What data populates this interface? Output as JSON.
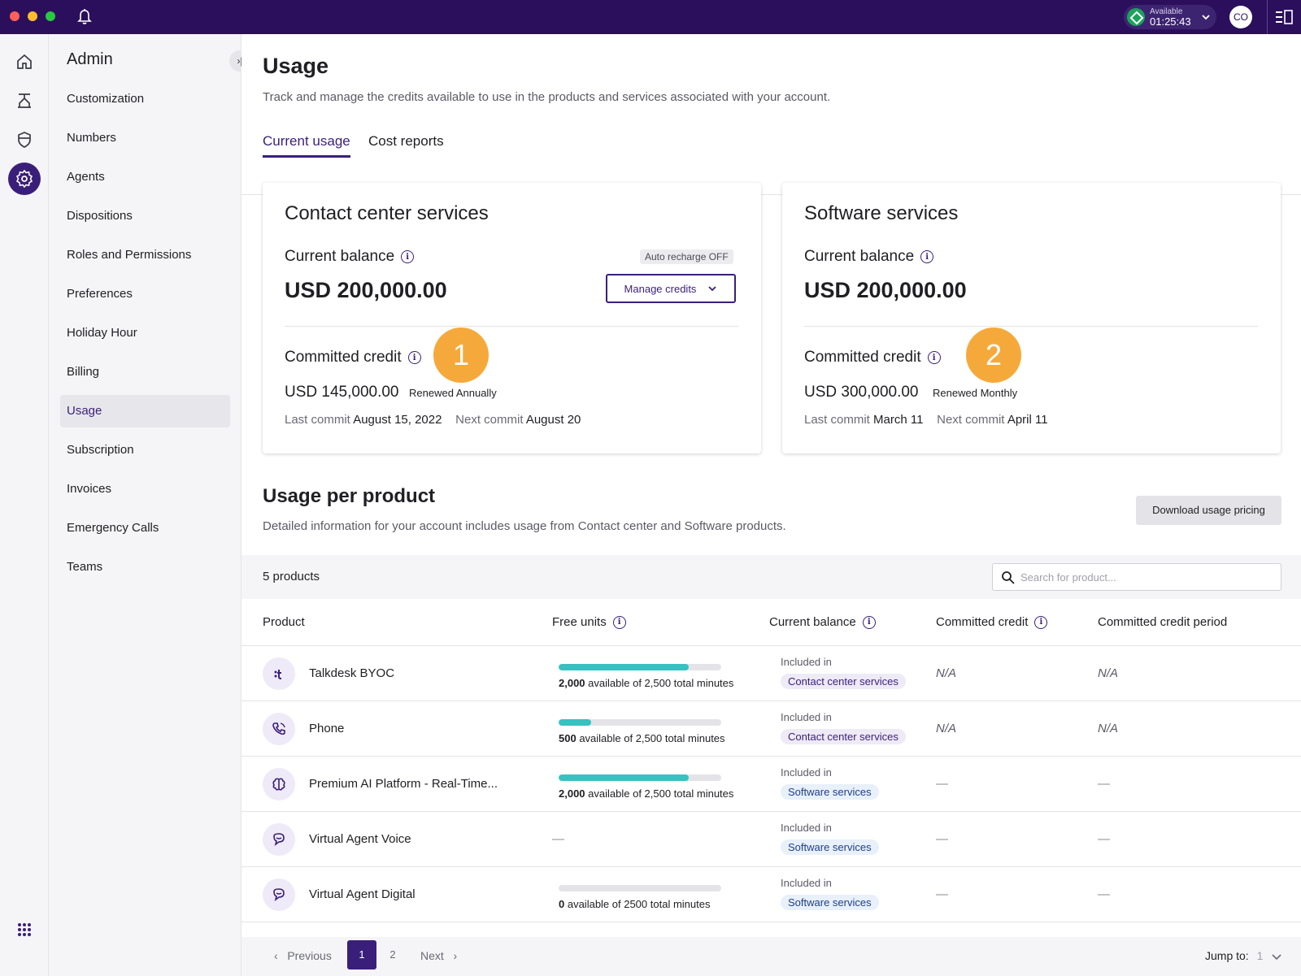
{
  "titlebar": {
    "status_label": "Available",
    "status_time": "01:25:43",
    "avatar_initials": "CO"
  },
  "sidenav": {
    "title": "Admin",
    "collapse_glyph": "›|",
    "items": [
      {
        "label": "Customization"
      },
      {
        "label": "Numbers"
      },
      {
        "label": "Agents"
      },
      {
        "label": "Dispositions"
      },
      {
        "label": "Roles and Permissions"
      },
      {
        "label": "Preferences"
      },
      {
        "label": "Holiday Hour"
      },
      {
        "label": "Billing"
      },
      {
        "label": "Usage",
        "active": true
      },
      {
        "label": "Subscription"
      },
      {
        "label": "Invoices"
      },
      {
        "label": "Emergency Calls"
      },
      {
        "label": "Teams"
      }
    ]
  },
  "page": {
    "title": "Usage",
    "description": "Track and manage the credits available to use in the products and services associated with your account.",
    "tabs": [
      {
        "label": "Current usage",
        "active": true
      },
      {
        "label": "Cost reports"
      }
    ]
  },
  "cards": {
    "contact": {
      "title": "Contact center services",
      "balance_label": "Current balance",
      "balance": "USD 200,000.00",
      "auto_recharge": "Auto recharge OFF",
      "manage_label": "Manage credits",
      "committed_label": "Committed credit",
      "marker": "1",
      "committed_amount": "USD 145,000.00",
      "renewed_prefix": "Renewed",
      "renewed_period": "Annually",
      "last_commit_label": "Last commit",
      "last_commit": "August 15, 2022",
      "next_commit_label": "Next commit",
      "next_commit": "August 20"
    },
    "software": {
      "title": "Software services",
      "balance_label": "Current balance",
      "balance": "USD 200,000.00",
      "committed_label": "Committed credit",
      "marker": "2",
      "committed_amount": "USD 300,000.00",
      "renewed_prefix": "Renewed",
      "renewed_period": "Monthly",
      "last_commit_label": "Last commit",
      "last_commit": "March 11",
      "next_commit_label": "Next commit",
      "next_commit": "April 11"
    }
  },
  "usage_section": {
    "title": "Usage per product",
    "description": "Detailed information for your account includes usage from Contact center and Software products.",
    "download_label": "Download usage pricing",
    "count_label": "5 products",
    "search_placeholder": "Search for product...",
    "columns": {
      "product": "Product",
      "free_units": "Free units",
      "current_balance": "Current balance",
      "committed_credit": "Committed credit",
      "committed_period": "Committed credit period"
    },
    "included_label": "Included in",
    "rows": [
      {
        "name": "Talkdesk BYOC",
        "icon": "byoc-icon",
        "free_fraction": 0.8,
        "free_bold": "2,000",
        "free_rest": " available of 2,500 total minutes",
        "included": "Contact center services",
        "committed": "N/A",
        "period": "N/A"
      },
      {
        "name": "Phone",
        "icon": "phone-icon",
        "free_fraction": 0.2,
        "free_bold": "500",
        "free_rest": " available of 2,500 total minutes",
        "included": "Contact center services",
        "committed": "N/A",
        "period": "N/A"
      },
      {
        "name": "Premium AI Platform - Real-Time...",
        "icon": "brain-icon",
        "free_fraction": 0.8,
        "free_bold": "2,000",
        "free_rest": " available of 2,500 total minutes",
        "included": "Software services",
        "committed": "—",
        "period": "—"
      },
      {
        "name": "Virtual Agent Voice",
        "icon": "chat-bot-icon",
        "free_dash": "—",
        "included": "Software services",
        "committed": "—",
        "period": "—"
      },
      {
        "name": "Virtual Agent Digital",
        "icon": "chat-bot-icon",
        "free_fraction": 0.0,
        "free_bold": "0",
        "free_rest": " available of 2500 total minutes",
        "included": "Software services",
        "committed": "—",
        "period": "—"
      }
    ]
  },
  "pagination": {
    "previous": "Previous",
    "pages": [
      "1",
      "2"
    ],
    "current": "1",
    "next": "Next",
    "jump_label": "Jump to:",
    "jump_value": "1"
  },
  "colors": {
    "brand": "#2b0f5c",
    "accent": "#3a1f7a",
    "marker": "#f6a93b",
    "progress": "#39c1c1",
    "status_available": "#1aa35b"
  }
}
